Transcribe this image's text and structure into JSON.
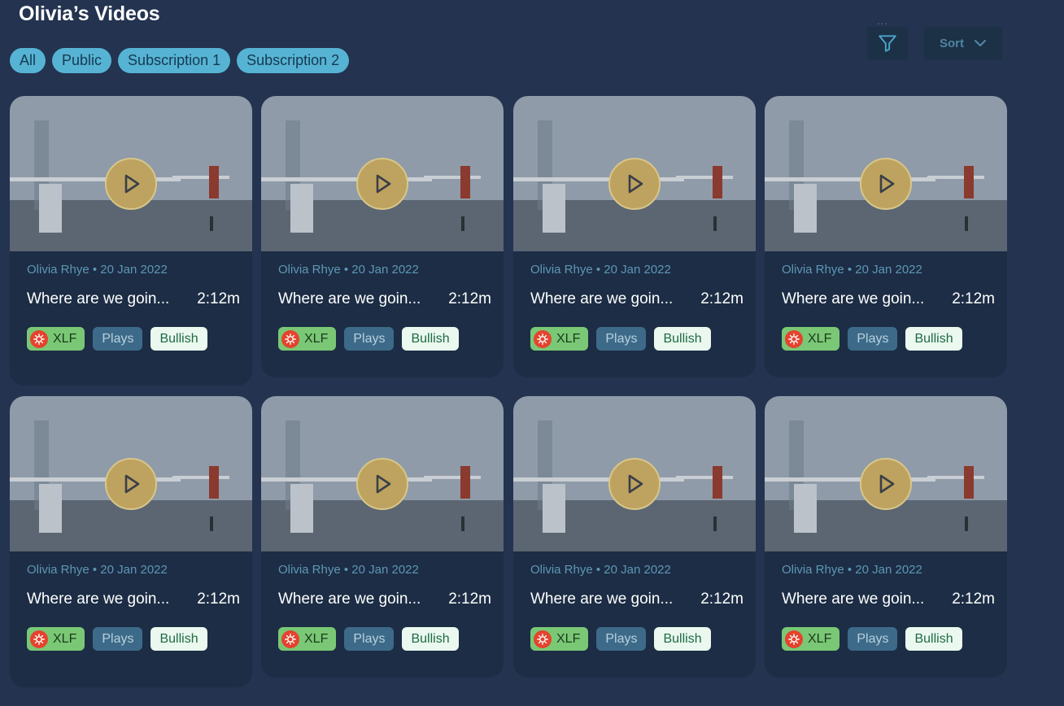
{
  "page": {
    "title": "Olivia’s Videos"
  },
  "filters": [
    {
      "label": "All"
    },
    {
      "label": "Public"
    },
    {
      "label": "Subscription 1"
    },
    {
      "label": "Subscription 2"
    }
  ],
  "toolbar": {
    "menu_dots": "...",
    "filter_icon": "filter-icon",
    "sort_label": "Sort",
    "sort_icon": "chevron-down-icon"
  },
  "colors": {
    "background": "#233350",
    "card": "#1c2d45",
    "filter_tab": "#56b3d3",
    "play_button": "#bda35f",
    "tag_xlf": "#7ac875",
    "tag_plays": "#3d6a88",
    "tag_bullish": "#eaf8ef"
  },
  "videos": [
    {
      "author": "Olivia Rhye",
      "date": "20 Jan 2022",
      "title": "Where are we goin...",
      "duration": "2:12m",
      "tags": [
        "XLF",
        "Plays",
        "Bullish"
      ]
    },
    {
      "author": "Olivia Rhye",
      "date": "20 Jan 2022",
      "title": "Where are we goin...",
      "duration": "2:12m",
      "tags": [
        "XLF",
        "Plays",
        "Bullish"
      ]
    },
    {
      "author": "Olivia Rhye",
      "date": "20 Jan 2022",
      "title": "Where are we goin...",
      "duration": "2:12m",
      "tags": [
        "XLF",
        "Plays",
        "Bullish"
      ]
    },
    {
      "author": "Olivia Rhye",
      "date": "20 Jan 2022",
      "title": "Where are we goin...",
      "duration": "2:12m",
      "tags": [
        "XLF",
        "Plays",
        "Bullish"
      ]
    },
    {
      "author": "Olivia Rhye",
      "date": "20 Jan 2022",
      "title": "Where are we goin...",
      "duration": "2:12m",
      "tags": [
        "XLF",
        "Plays",
        "Bullish"
      ]
    },
    {
      "author": "Olivia Rhye",
      "date": "20 Jan 2022",
      "title": "Where are we goin...",
      "duration": "2:12m",
      "tags": [
        "XLF",
        "Plays",
        "Bullish"
      ]
    },
    {
      "author": "Olivia Rhye",
      "date": "20 Jan 2022",
      "title": "Where are we goin...",
      "duration": "2:12m",
      "tags": [
        "XLF",
        "Plays",
        "Bullish"
      ]
    },
    {
      "author": "Olivia Rhye",
      "date": "20 Jan 2022",
      "title": "Where are we goin...",
      "duration": "2:12m",
      "tags": [
        "XLF",
        "Plays",
        "Bullish"
      ]
    }
  ]
}
